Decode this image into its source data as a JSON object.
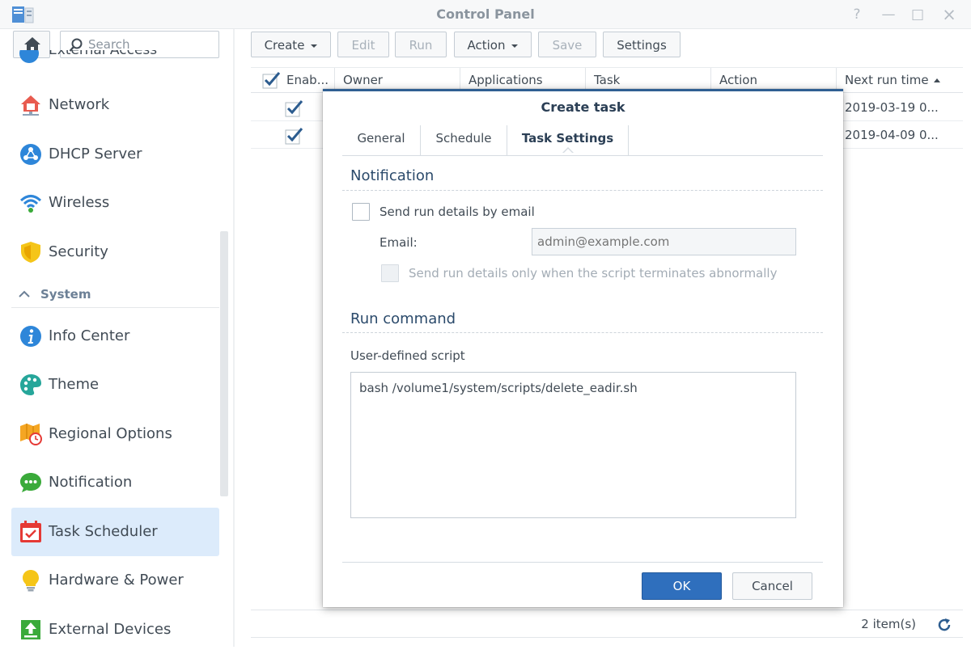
{
  "window": {
    "title": "Control Panel",
    "controls": [
      "?",
      "—",
      "□",
      "×"
    ]
  },
  "sidebar": {
    "search_placeholder": "Search",
    "cutoff_item": "External Access",
    "items": [
      {
        "label": "Network",
        "icon": "house-network-icon"
      },
      {
        "label": "DHCP Server",
        "icon": "dhcp-icon"
      },
      {
        "label": "Wireless",
        "icon": "wifi-icon"
      },
      {
        "label": "Security",
        "icon": "shield-icon"
      }
    ],
    "section": "System",
    "system_items": [
      {
        "label": "Info Center",
        "icon": "info-icon"
      },
      {
        "label": "Theme",
        "icon": "palette-icon"
      },
      {
        "label": "Regional Options",
        "icon": "map-clock-icon"
      },
      {
        "label": "Notification",
        "icon": "chat-bubble-icon"
      },
      {
        "label": "Task Scheduler",
        "icon": "calendar-check-icon",
        "active": true
      },
      {
        "label": "Hardware & Power",
        "icon": "lightbulb-icon"
      },
      {
        "label": "External Devices",
        "icon": "upload-icon"
      }
    ]
  },
  "toolbar": {
    "create": "Create",
    "edit": "Edit",
    "run": "Run",
    "action": "Action",
    "save": "Save",
    "settings": "Settings"
  },
  "grid": {
    "columns": [
      "Enab...",
      "Owner",
      "Applications",
      "Task",
      "Action",
      "Next run time"
    ],
    "rows": [
      {
        "enabled": true,
        "next_run": "2019-03-19 0..."
      },
      {
        "enabled": true,
        "next_run": "2019-04-09 0..."
      }
    ],
    "item_count": "2 item(s)"
  },
  "dialog": {
    "title": "Create task",
    "tabs": [
      "General",
      "Schedule",
      "Task Settings"
    ],
    "active_tab": "Task Settings",
    "notification": {
      "title": "Notification",
      "send_email_label": "Send run details by email",
      "send_email_checked": false,
      "email_label": "Email:",
      "email_placeholder": "admin@example.com",
      "abnormal_label": "Send run details only when the script terminates abnormally",
      "abnormal_checked": false
    },
    "run_command": {
      "title": "Run command",
      "script_label": "User-defined script",
      "script_value": "bash /volume1/system/scripts/delete_eadir.sh"
    },
    "ok": "OK",
    "cancel": "Cancel"
  },
  "colors": {
    "accent": "#2f6fbd",
    "dialog_border": "#2f5f92",
    "active_nav": "#dcebfb"
  }
}
